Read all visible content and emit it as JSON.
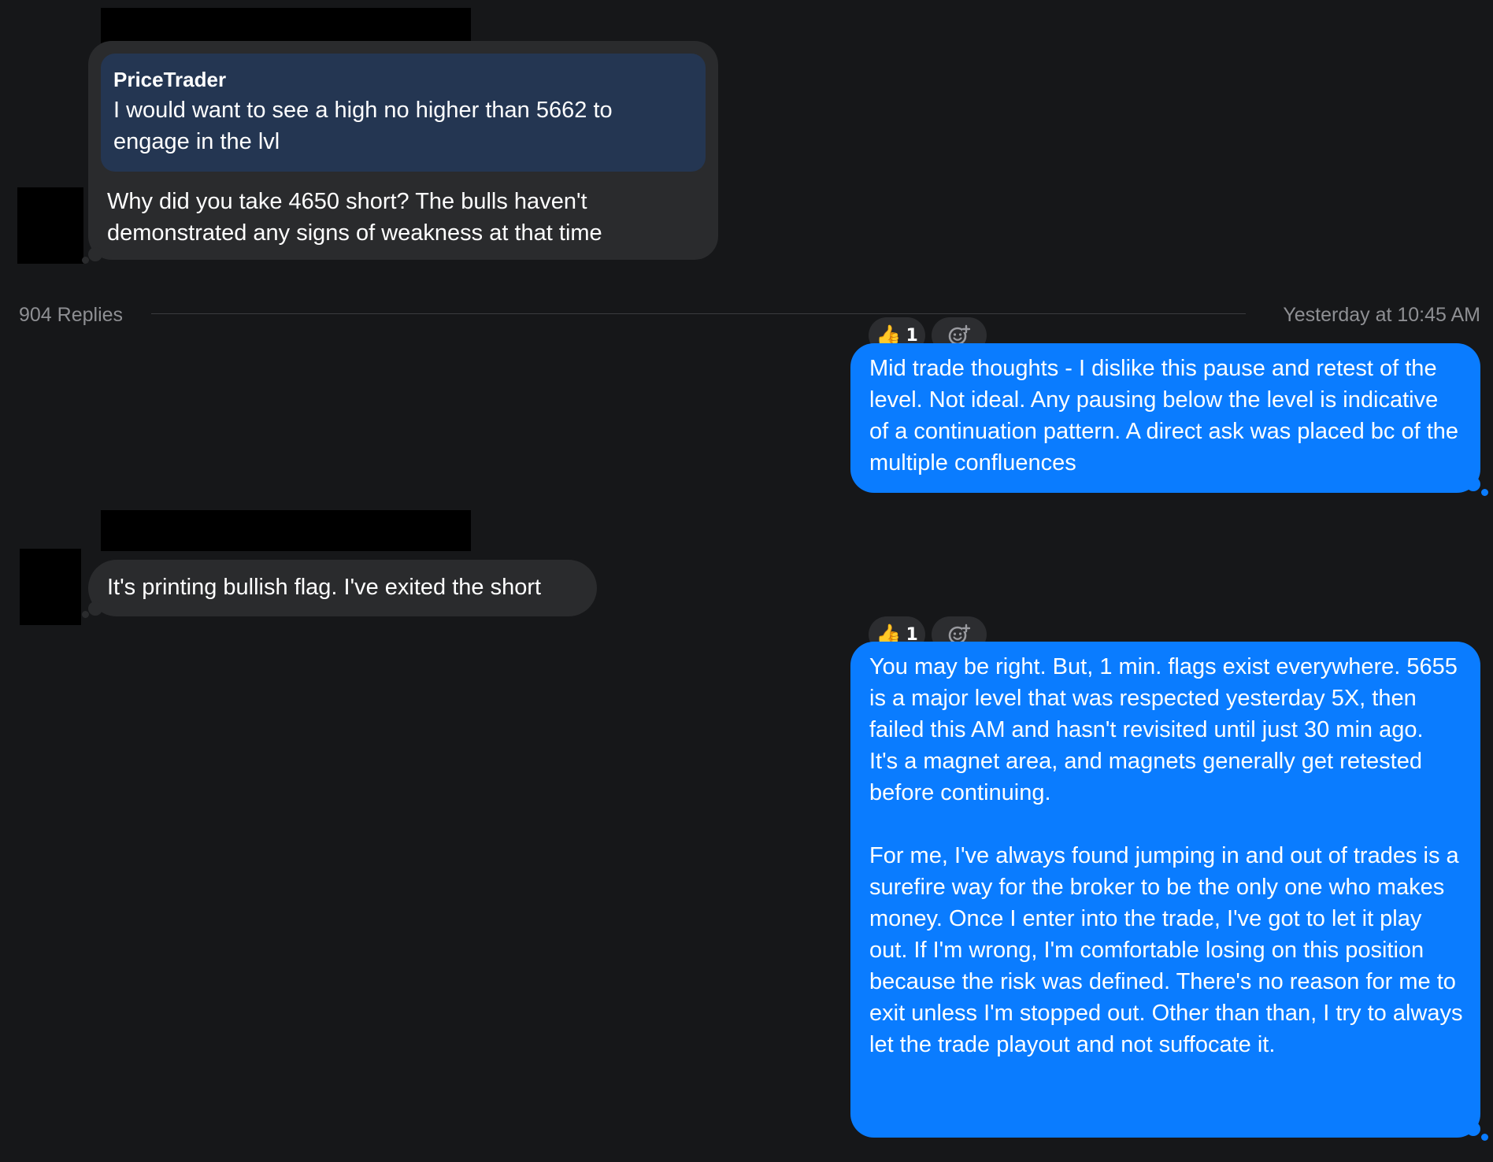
{
  "thread": {
    "message1": {
      "quote": {
        "author": "PriceTrader",
        "text": "I would want to see a high no higher than 5662 to engage in the lvl"
      },
      "text": "Why did you take 4650 short? The bulls haven't demonstrated any signs of weakness at that time"
    },
    "divider": {
      "replies": "904 Replies",
      "timestamp": "Yesterday at 10:45 AM"
    },
    "message2": {
      "reaction_emoji": "👍",
      "reaction_count": "1",
      "add_reaction_icon": "add-reaction-icon",
      "text": "Mid trade thoughts - I dislike this pause and retest of the level. Not ideal. Any pausing below the level is indicative of a continuation pattern. A direct ask was placed bc of the multiple confluences"
    },
    "message3": {
      "text": "It's printing bullish flag. I've exited the short"
    },
    "message4": {
      "reaction_emoji": "👍",
      "reaction_count": "1",
      "add_reaction_icon": "add-reaction-icon",
      "text": "You may be right. But, 1 min. flags exist everywhere. 5655 is a major level that was respected yesterday 5X, then failed this AM and hasn't revisited until just 30 min ago.\nIt's a magnet area, and magnets generally get retested before continuing.\n\nFor me, I've always found jumping in and out of trades is a surefire way for the broker to be the only one who makes money. Once I enter into the trade, I've got to let it play out. If I'm wrong, I'm comfortable losing on this position because the risk was defined. There's no reason for me to exit unless I'm stopped out. Other than than, I try to always let the trade playout and not suffocate it."
    }
  },
  "colors": {
    "background": "#161719",
    "incoming_bubble": "#2a2b2d",
    "quote_bubble": "#243652",
    "outgoing_bubble": "#0a7cff",
    "muted_text": "#8e8f93"
  }
}
